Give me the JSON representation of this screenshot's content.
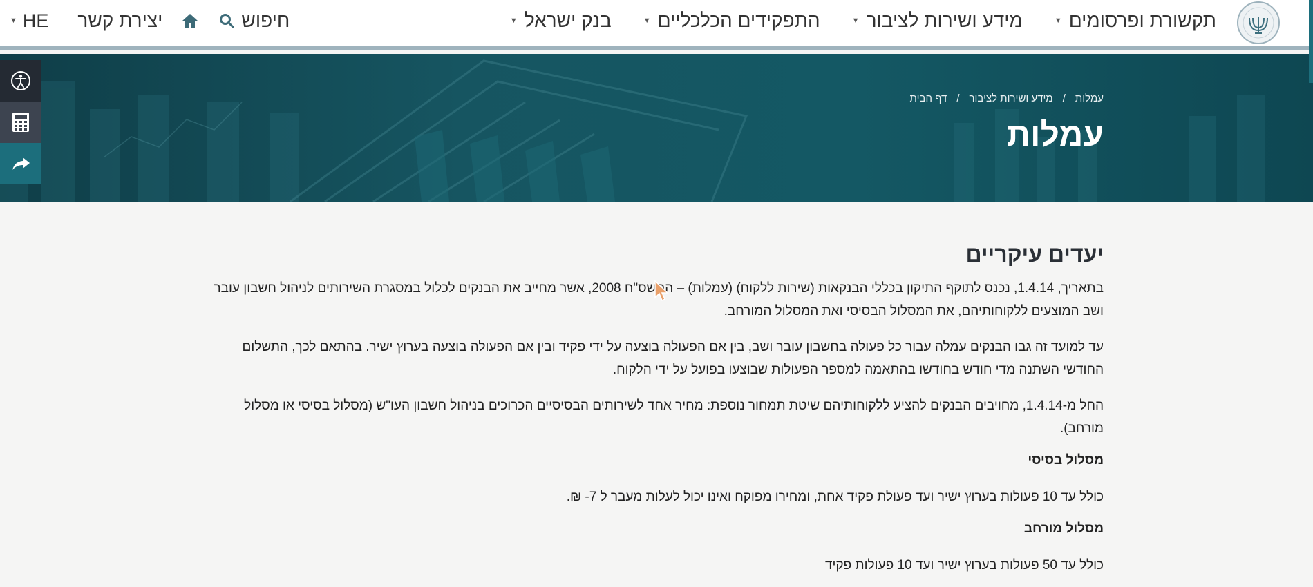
{
  "header": {
    "nav": [
      {
        "label": "בנק ישראל"
      },
      {
        "label": "התפקידים הכלכליים"
      },
      {
        "label": "מידע ושירות לציבור"
      },
      {
        "label": "תקשורת ופרסומים"
      }
    ],
    "search_label": "חיפוש",
    "contact_label": "יצירת קשר",
    "language": "HE"
  },
  "hero": {
    "breadcrumbs": [
      "דף הבית",
      "/",
      "מידע ושירות לציבור",
      "/",
      "עמלות"
    ],
    "title": "עמלות"
  },
  "content": {
    "heading": "יעדים עיקריים",
    "paragraphs": [
      "בתאריך, 1.4.14, נכנס לתוקף התיקון בכללי הבנקאות (שירות ללקוח) (עמלות) – התשס\"ח 2008, אשר מחייב את הבנקים לכלול במסגרת השירותים לניהול חשבון עובר ושב המוצעים ללקוחותיהם, את המסלול הבסיסי ואת המסלול המורחב.",
      "עד למועד זה גבו הבנקים עמלה עבור כל פעולה בחשבון עובר ושב, בין אם הפעולה בוצעה על ידי פקיד ובין אם הפעולה בוצעה בערוץ ישיר. בהתאם לכך, התשלום החודשי השתנה מדי חודש בחודשו בהתאמה למספר הפעולות שבוצעו בפועל על ידי הלקוח.",
      "החל מ-1.4.14, מחויבים הבנקים להציע ללקוחותיהם שיטת תמחור נוספת: מחיר אחד לשירותים הבסיסיים הכרוכים בניהול חשבון העו\"ש (מסלול בסיסי או מסלול מורחב)."
    ],
    "basic_heading": "מסלול בסיסי",
    "basic_text": "כולל עד 10 פעולות בערוץ ישיר ועד פעולת פקיד אחת, ומחירו מפוקח ואינו יכול לעלות מעבר ל 7- ₪.",
    "extended_heading": "מסלול מורחב",
    "extended_text": "כולל עד 50 פעולות בערוץ ישיר ועד 10 פעולות פקיד"
  },
  "icons": {
    "accessibility": "accessibility-icon",
    "calculator": "calculator-icon",
    "share": "share-icon",
    "home": "home-icon",
    "search": "search-icon",
    "logo": "bank-of-israel-menorah-logo"
  },
  "colors": {
    "hero": "#145864",
    "accent": "#1c6e7c",
    "tool_dark": "#242a33"
  }
}
